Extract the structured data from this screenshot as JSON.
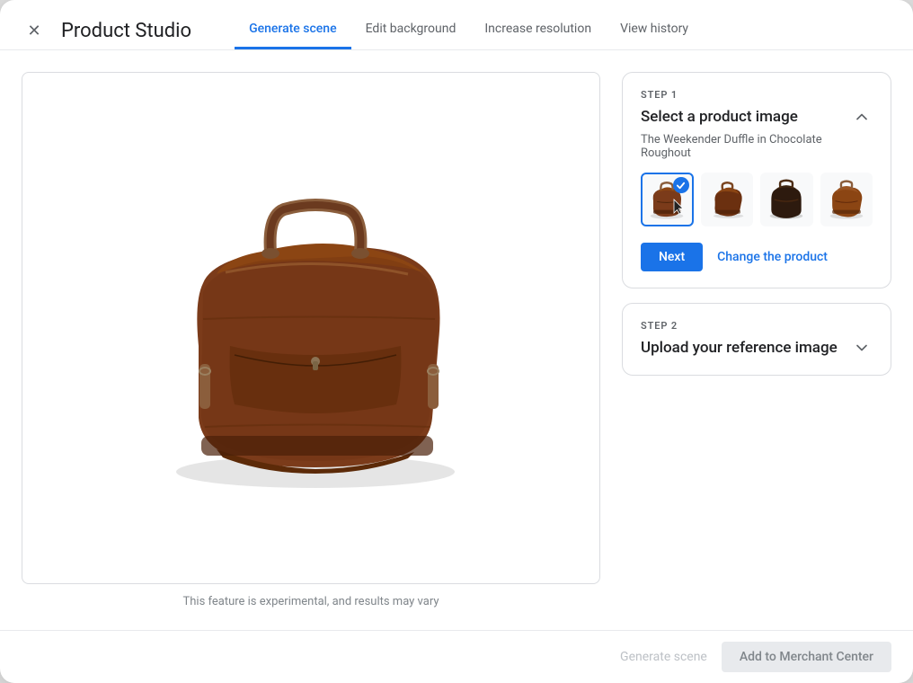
{
  "window": {
    "title": "Product Studio"
  },
  "header": {
    "close_label": "×",
    "title": "Product Studio"
  },
  "tabs": [
    {
      "id": "generate-scene",
      "label": "Generate scene",
      "active": true
    },
    {
      "id": "edit-background",
      "label": "Edit background",
      "active": false
    },
    {
      "id": "increase-resolution",
      "label": "Increase resolution",
      "active": false
    },
    {
      "id": "view-history",
      "label": "View history",
      "active": false
    }
  ],
  "main_image": {
    "caption": "This feature is experimental, and results may vary"
  },
  "step1": {
    "step_label": "STEP 1",
    "title": "Select a product image",
    "subtitle": "The Weekender Duffle in Chocolate Roughout",
    "thumbnails": [
      {
        "id": "thumb-1",
        "selected": true,
        "alt": "Front view"
      },
      {
        "id": "thumb-2",
        "selected": false,
        "alt": "Angle view"
      },
      {
        "id": "thumb-3",
        "selected": false,
        "alt": "Top view"
      },
      {
        "id": "thumb-4",
        "selected": false,
        "alt": "Side view"
      }
    ],
    "next_label": "Next",
    "change_product_label": "Change the product"
  },
  "step2": {
    "step_label": "STEP 2",
    "title": "Upload your reference image"
  },
  "footer": {
    "generate_scene_label": "Generate scene",
    "add_to_merchant_label": "Add to Merchant Center"
  },
  "icons": {
    "close": "✕",
    "chevron_up": "expand_less",
    "chevron_down": "expand_more",
    "check": "✓"
  }
}
